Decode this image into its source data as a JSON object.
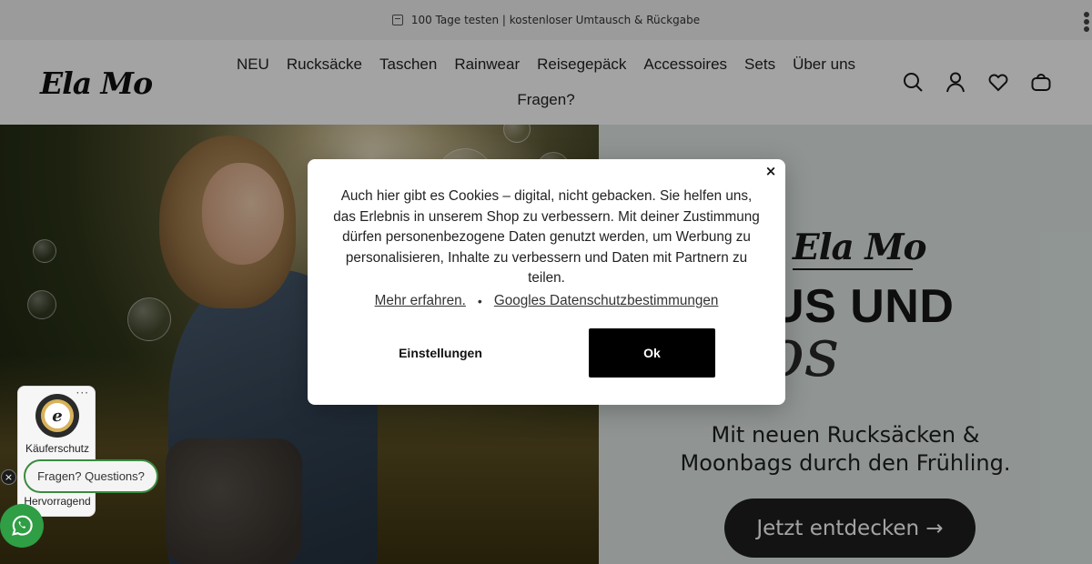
{
  "announcement": {
    "text": "100 Tage testen | kostenloser Umtausch & Rückgabe",
    "icon": "calendar-icon"
  },
  "header": {
    "logo": "Ela Mo",
    "nav": [
      "NEU",
      "Rucksäcke",
      "Taschen",
      "Rainwear",
      "Reisegepäck",
      "Accessoires",
      "Sets",
      "Über uns",
      "Fragen?"
    ],
    "icons": [
      "search-icon",
      "account-icon",
      "wishlist-heart-icon",
      "cart-bag-icon"
    ]
  },
  "hero": {
    "brand": "Ela Mo",
    "headline": "AUS UND",
    "script": "los",
    "subline_1": "Mit neuen Rucksäcken &",
    "subline_2": "Moonbags durch den Frühling.",
    "cta": "Jetzt entdecken →"
  },
  "cookie": {
    "text": "Auch hier gibt es Cookies – digital, nicht gebacken. Sie helfen uns, das Erlebnis in unserem Shop zu verbessern. Mit deiner Zustimmung dürfen personenbezogene Daten genutzt werden, um Werbung zu personalisieren, Inhalte zu verbessern und Daten mit Partnern zu teilen.",
    "link_more": "Mehr erfahren.",
    "separator": "•",
    "link_google": "Googles Datenschutzbestimmungen",
    "settings_label": "Einstellungen",
    "ok_label": "Ok",
    "close": "×"
  },
  "trusted": {
    "seal_letter": "e",
    "label": "Käuferschutz",
    "rating": "Hervorragend",
    "menu": "···"
  },
  "chat": {
    "label": "Fragen? Questions?",
    "close": "×"
  },
  "colors": {
    "overlay": "#000000",
    "ok_button": "#000000",
    "hero_bg": "#e1eae8",
    "whatsapp": "#2f9e44"
  }
}
